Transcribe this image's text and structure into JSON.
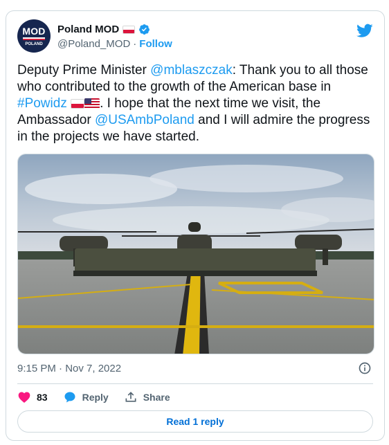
{
  "author": {
    "display_name": "Poland MOD",
    "handle": "@Poland_MOD",
    "separator": "·",
    "follow_label": "Follow",
    "avatar_text": "MOD",
    "avatar_subtext": "POLAND"
  },
  "tweet": {
    "text_parts": {
      "p1": "Deputy Prime Minister ",
      "mention1": "@mblaszczak",
      "p2": ": Thank you to all those who contributed to the growth of the American base in ",
      "hashtag": "#Powidz",
      "p3": ". I hope that the next time we visit, the Ambassador ",
      "mention2": "@USAmbPoland",
      "p4": " and I will admire the progress in the projects we have started."
    },
    "timestamp": "9:15 PM · Nov 7, 2022"
  },
  "actions": {
    "likes_count": "83",
    "reply_label": "Reply",
    "share_label": "Share",
    "read_replies_label": "Read 1 reply"
  },
  "icons": {
    "brand": "twitter-bird-icon",
    "verified": "verified-badge-icon",
    "like": "heart-icon",
    "reply": "speech-bubble-icon",
    "share": "share-upload-icon",
    "info": "info-icon"
  },
  "colors": {
    "accent": "#1d9bf0",
    "like": "#f91880",
    "text": "#0f1419",
    "muted": "#536471",
    "border": "#cfd9de"
  }
}
